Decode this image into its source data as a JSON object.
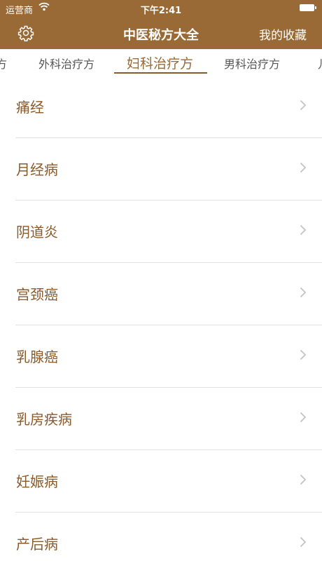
{
  "status_bar": {
    "carrier": "运营商",
    "time": "下午2:41"
  },
  "nav": {
    "title": "中医秘方大全",
    "favorites_label": "我的收藏",
    "left_icon": "gear-icon"
  },
  "tabs": [
    {
      "label": "方",
      "active": false
    },
    {
      "label": "外科治疗方",
      "active": false
    },
    {
      "label": "妇科治疗方",
      "active": true
    },
    {
      "label": "男科治疗方",
      "active": false
    },
    {
      "label": "儿",
      "active": false
    }
  ],
  "list": {
    "items": [
      {
        "label": "痛经"
      },
      {
        "label": "月经病"
      },
      {
        "label": "阴道炎"
      },
      {
        "label": "宫颈癌"
      },
      {
        "label": "乳腺癌"
      },
      {
        "label": "乳房疾病"
      },
      {
        "label": "妊娠病"
      },
      {
        "label": "产后病"
      }
    ]
  },
  "colors": {
    "brand": "#9a6a36",
    "item_text": "#8a5a2a",
    "divider": "#e2e2e2"
  }
}
